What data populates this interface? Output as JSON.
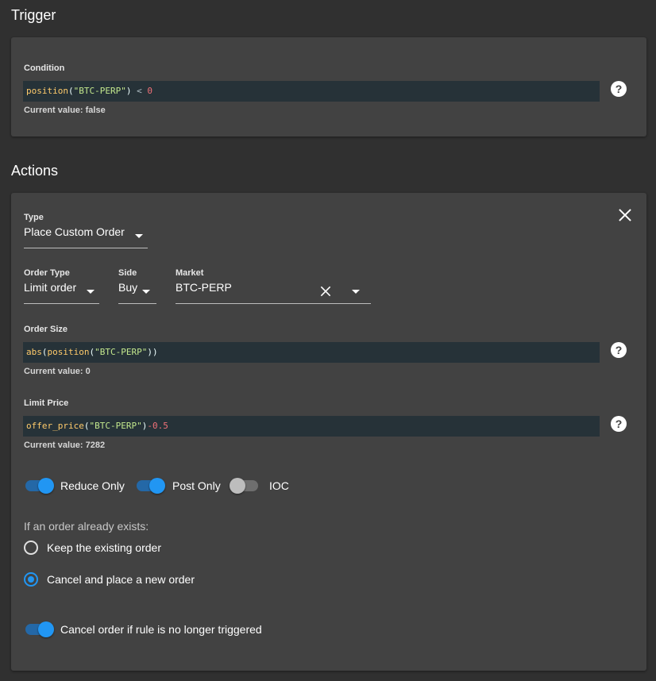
{
  "trigger": {
    "title": "Trigger",
    "condition_label": "Condition",
    "condition_code": {
      "fn": "position",
      "open": "(",
      "str": "\"BTC-PERP\"",
      "close": ")",
      "op": " < ",
      "num": "0"
    },
    "current_value": "Current value: false"
  },
  "actions": {
    "title": "Actions",
    "type_label": "Type",
    "type_value": "Place Custom Order",
    "order_type_label": "Order Type",
    "order_type_value": "Limit order",
    "side_label": "Side",
    "side_value": "Buy",
    "market_label": "Market",
    "market_value": "BTC-PERP",
    "order_size_label": "Order Size",
    "order_size_code": {
      "fn1": "abs",
      "open1": "(",
      "fn2": "position",
      "open2": "(",
      "str": "\"BTC-PERP\"",
      "close2": ")",
      "close1": ")"
    },
    "order_size_current": "Current value: 0",
    "limit_price_label": "Limit Price",
    "limit_price_code": {
      "fn": "offer_price",
      "open": "(",
      "str": "\"BTC-PERP\"",
      "close": ")",
      "op": "-",
      "num": "0.5"
    },
    "limit_price_current": "Current value: 7282",
    "toggles": [
      {
        "label": "Reduce Only",
        "on": true
      },
      {
        "label": "Post Only",
        "on": true
      },
      {
        "label": "IOC",
        "on": false
      }
    ],
    "exists_question": "If an order already exists:",
    "radio_options": [
      {
        "label": "Keep the existing order",
        "checked": false
      },
      {
        "label": "Cancel and place a new order",
        "checked": true
      }
    ],
    "cancel_toggle": {
      "label": "Cancel order if rule is no longer triggered",
      "on": true
    }
  },
  "icons": {
    "help": "?",
    "help_icon_name": "help-circle-icon",
    "close_icon_name": "close-icon"
  },
  "colors": {
    "background": "#303030",
    "card": "#424242",
    "code_bg": "#263238",
    "accent": "#2196f3"
  }
}
